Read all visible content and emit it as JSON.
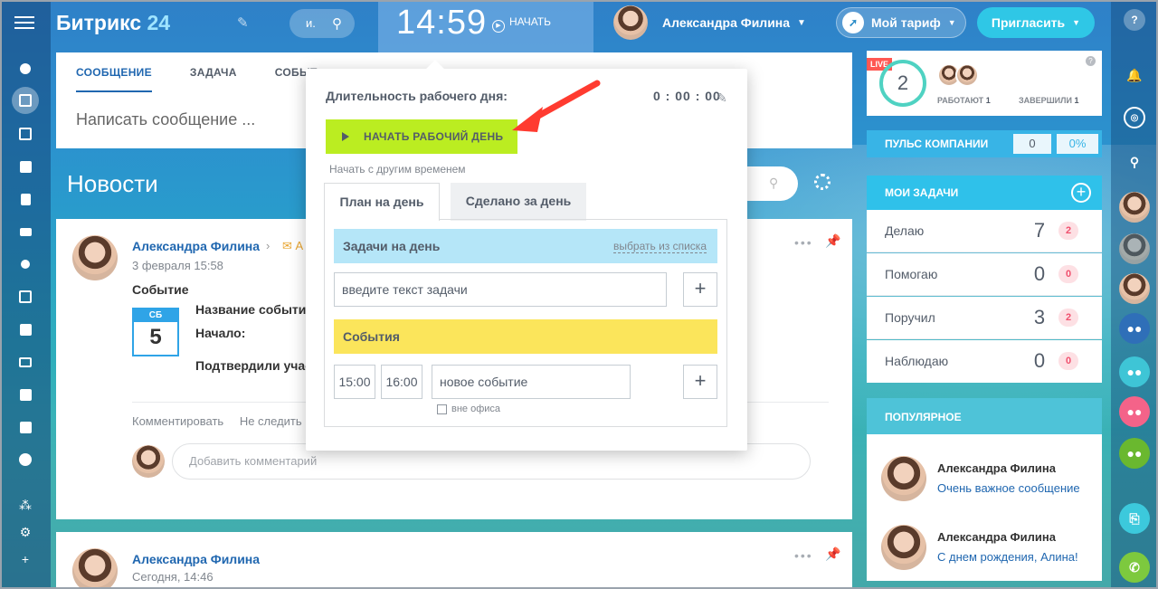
{
  "header": {
    "logo_name": "Битрикс",
    "logo_num": "24",
    "search_label": "и.",
    "clock": "14:59",
    "start_label": "НАЧАТЬ",
    "user_name": "Александра Филина",
    "tariff_label": "Мой тариф",
    "invite_label": "Пригласить"
  },
  "composer": {
    "tabs": [
      "СООБЩЕНИЕ",
      "ЗАДАЧА",
      "СОБЫТ"
    ],
    "placeholder": "Написать сообщение ..."
  },
  "feed": {
    "title": "Новости",
    "post1": {
      "author": "Александра Филина",
      "target_initial": "А",
      "date": "3 февраля 15:58",
      "type": "Событие",
      "cal_day_name": "СБ",
      "cal_day": "5",
      "field_name": "Название событи",
      "field_start": "Начало:",
      "field_confirmed": "Подтвердили учас",
      "action_comment": "Комментировать",
      "action_unfollow": "Не следить",
      "comment_placeholder": "Добавить комментарий"
    },
    "post2": {
      "author": "Александра Филина",
      "date": "Сегодня, 14:46"
    }
  },
  "workday_popup": {
    "duration_label": "Длительность рабочего дня:",
    "duration_value": "0 : 00 : 00",
    "start_day_button": "НАЧАТЬ РАБОЧИЙ ДЕНЬ",
    "other_time_link": "Начать с другим временем",
    "tabs": [
      "План на день",
      "Сделано за день"
    ],
    "tasks_title": "Задачи на день",
    "pick_from_list": "выбрать из списка",
    "task_placeholder": "введите текст задачи",
    "events_title": "События",
    "event_from": "15:00",
    "event_to": "16:00",
    "event_placeholder": "новое событие",
    "out_of_office": "вне офиса"
  },
  "live": {
    "badge": "LIVE",
    "count": "2",
    "working_label": "РАБОТАЮТ",
    "working_count": "1",
    "finished_label": "ЗАВЕРШИЛИ",
    "finished_count": "1"
  },
  "pulse": {
    "title": "ПУЛЬС КОМПАНИИ",
    "value": "0",
    "percent": "0%"
  },
  "my_tasks": {
    "title": "МОИ ЗАДАЧИ",
    "rows": [
      {
        "label": "Делаю",
        "count": "7",
        "badge": "2"
      },
      {
        "label": "Помогаю",
        "count": "0",
        "badge": "0"
      },
      {
        "label": "Поручил",
        "count": "3",
        "badge": "2"
      },
      {
        "label": "Наблюдаю",
        "count": "0",
        "badge": "0"
      }
    ]
  },
  "popular": {
    "title": "ПОПУЛЯРНОЕ",
    "items": [
      {
        "name": "Александра Филина",
        "text": "Очень важное сообщение"
      },
      {
        "name": "Александра Филина",
        "text": "С днем рождения, Алина!"
      }
    ]
  },
  "colors": {
    "start_day_green": "#bbed21",
    "events_yellow": "#fbe55b",
    "tasks_blue": "#b5e6f8",
    "accent_blue": "#2067b0",
    "invite_cyan": "#2fc7e6"
  }
}
